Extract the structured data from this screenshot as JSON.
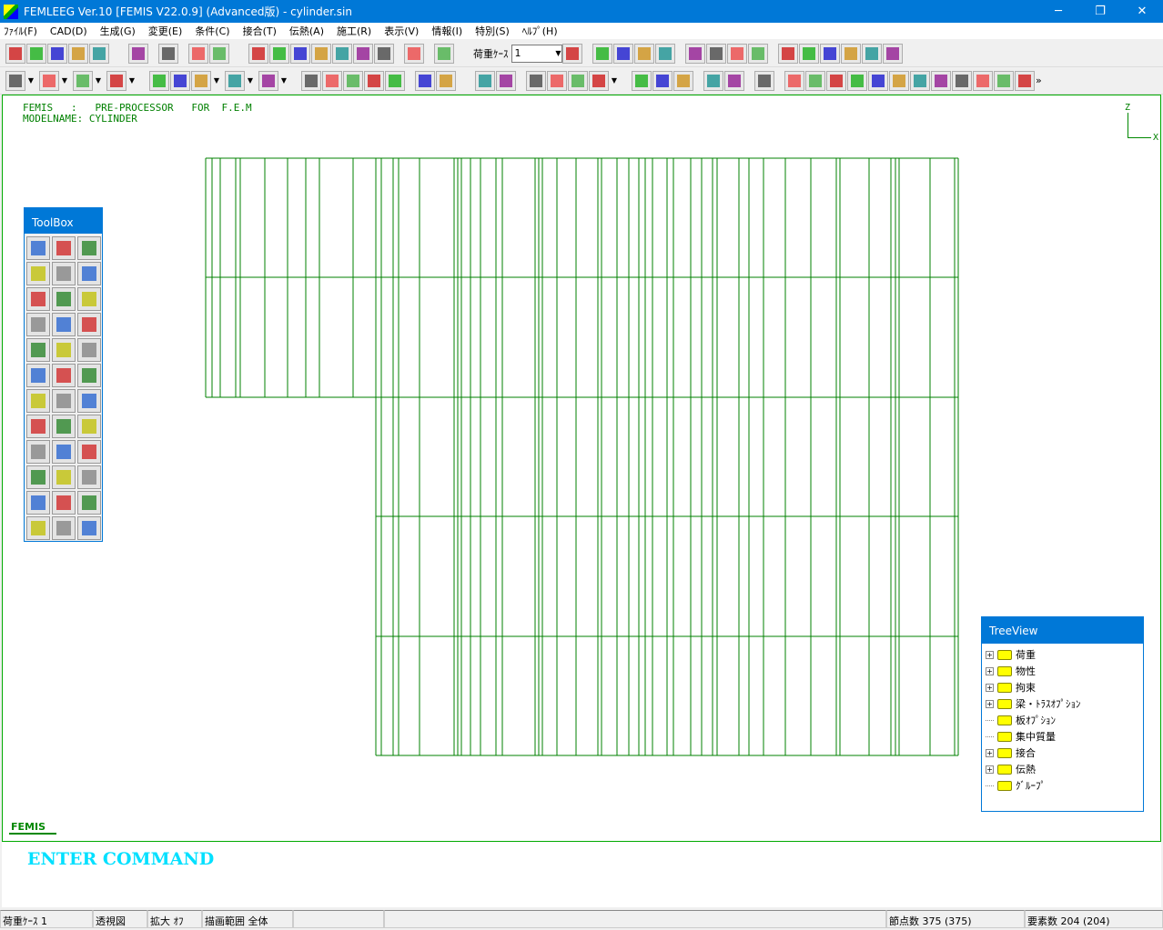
{
  "window": {
    "title": "FEMLEEG Ver.10 [FEMIS V22.0.9] (Advanced版) - cylinder.sin",
    "minimize": "─",
    "maximize": "❐",
    "close": "✕"
  },
  "menu": [
    "ﾌｧｲﾙ(F)",
    "CAD(D)",
    "生成(G)",
    "変更(E)",
    "条件(C)",
    "接合(T)",
    "伝熱(A)",
    "施工(R)",
    "表示(V)",
    "情報(I)",
    "特別(S)",
    "ﾍﾙﾌﾟ(H)"
  ],
  "toolbar": {
    "load_case_label": "荷重ｹｰｽ",
    "load_case_value": "1",
    "more": "»"
  },
  "canvas": {
    "header_line1": "FEMIS   :   PRE-PROCESSOR   FOR  F.E.M",
    "header_line2": "MODELNAME: CYLINDER",
    "axis_z": "Z",
    "axis_x": "X",
    "mesh_color": "#008000"
  },
  "toolbox": {
    "title": "ToolBox"
  },
  "treeview": {
    "title": "TreeView",
    "items": [
      {
        "label": "荷重",
        "expandable": true
      },
      {
        "label": "物性",
        "expandable": true
      },
      {
        "label": "拘束",
        "expandable": true
      },
      {
        "label": "梁・ﾄﾗｽｵﾌﾟｼｮﾝ",
        "expandable": true
      },
      {
        "label": "板ｵﾌﾟｼｮﾝ",
        "expandable": false
      },
      {
        "label": "集中質量",
        "expandable": false
      },
      {
        "label": "接合",
        "expandable": true
      },
      {
        "label": "伝熱",
        "expandable": true
      },
      {
        "label": "ｸﾞﾙｰﾌﾟ",
        "expandable": false
      }
    ]
  },
  "logo": "FEMIS",
  "command": "ENTER COMMAND",
  "status": {
    "load_case": "荷重ｹｰｽ 1",
    "view": "透視図",
    "zoom": "拡大 ｵﾌ",
    "range": "描画範囲 全体",
    "nodes": "節点数 375 (375)",
    "elements": "要素数 204 (204)"
  }
}
